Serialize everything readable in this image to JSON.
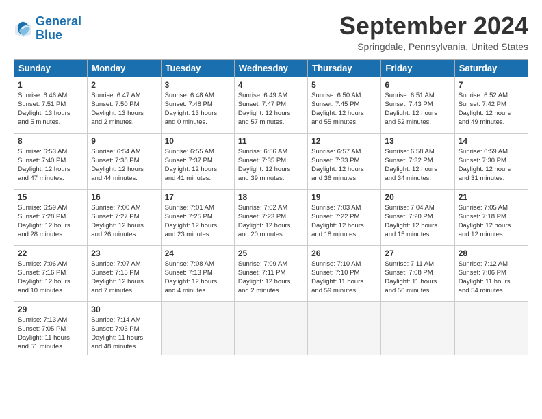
{
  "logo": {
    "line1": "General",
    "line2": "Blue"
  },
  "title": "September 2024",
  "location": "Springdale, Pennsylvania, United States",
  "weekdays": [
    "Sunday",
    "Monday",
    "Tuesday",
    "Wednesday",
    "Thursday",
    "Friday",
    "Saturday"
  ],
  "weeks": [
    [
      {
        "day": "1",
        "info": "Sunrise: 6:46 AM\nSunset: 7:51 PM\nDaylight: 13 hours\nand 5 minutes."
      },
      {
        "day": "2",
        "info": "Sunrise: 6:47 AM\nSunset: 7:50 PM\nDaylight: 13 hours\nand 2 minutes."
      },
      {
        "day": "3",
        "info": "Sunrise: 6:48 AM\nSunset: 7:48 PM\nDaylight: 13 hours\nand 0 minutes."
      },
      {
        "day": "4",
        "info": "Sunrise: 6:49 AM\nSunset: 7:47 PM\nDaylight: 12 hours\nand 57 minutes."
      },
      {
        "day": "5",
        "info": "Sunrise: 6:50 AM\nSunset: 7:45 PM\nDaylight: 12 hours\nand 55 minutes."
      },
      {
        "day": "6",
        "info": "Sunrise: 6:51 AM\nSunset: 7:43 PM\nDaylight: 12 hours\nand 52 minutes."
      },
      {
        "day": "7",
        "info": "Sunrise: 6:52 AM\nSunset: 7:42 PM\nDaylight: 12 hours\nand 49 minutes."
      }
    ],
    [
      {
        "day": "8",
        "info": "Sunrise: 6:53 AM\nSunset: 7:40 PM\nDaylight: 12 hours\nand 47 minutes."
      },
      {
        "day": "9",
        "info": "Sunrise: 6:54 AM\nSunset: 7:38 PM\nDaylight: 12 hours\nand 44 minutes."
      },
      {
        "day": "10",
        "info": "Sunrise: 6:55 AM\nSunset: 7:37 PM\nDaylight: 12 hours\nand 41 minutes."
      },
      {
        "day": "11",
        "info": "Sunrise: 6:56 AM\nSunset: 7:35 PM\nDaylight: 12 hours\nand 39 minutes."
      },
      {
        "day": "12",
        "info": "Sunrise: 6:57 AM\nSunset: 7:33 PM\nDaylight: 12 hours\nand 36 minutes."
      },
      {
        "day": "13",
        "info": "Sunrise: 6:58 AM\nSunset: 7:32 PM\nDaylight: 12 hours\nand 34 minutes."
      },
      {
        "day": "14",
        "info": "Sunrise: 6:59 AM\nSunset: 7:30 PM\nDaylight: 12 hours\nand 31 minutes."
      }
    ],
    [
      {
        "day": "15",
        "info": "Sunrise: 6:59 AM\nSunset: 7:28 PM\nDaylight: 12 hours\nand 28 minutes."
      },
      {
        "day": "16",
        "info": "Sunrise: 7:00 AM\nSunset: 7:27 PM\nDaylight: 12 hours\nand 26 minutes."
      },
      {
        "day": "17",
        "info": "Sunrise: 7:01 AM\nSunset: 7:25 PM\nDaylight: 12 hours\nand 23 minutes."
      },
      {
        "day": "18",
        "info": "Sunrise: 7:02 AM\nSunset: 7:23 PM\nDaylight: 12 hours\nand 20 minutes."
      },
      {
        "day": "19",
        "info": "Sunrise: 7:03 AM\nSunset: 7:22 PM\nDaylight: 12 hours\nand 18 minutes."
      },
      {
        "day": "20",
        "info": "Sunrise: 7:04 AM\nSunset: 7:20 PM\nDaylight: 12 hours\nand 15 minutes."
      },
      {
        "day": "21",
        "info": "Sunrise: 7:05 AM\nSunset: 7:18 PM\nDaylight: 12 hours\nand 12 minutes."
      }
    ],
    [
      {
        "day": "22",
        "info": "Sunrise: 7:06 AM\nSunset: 7:16 PM\nDaylight: 12 hours\nand 10 minutes."
      },
      {
        "day": "23",
        "info": "Sunrise: 7:07 AM\nSunset: 7:15 PM\nDaylight: 12 hours\nand 7 minutes."
      },
      {
        "day": "24",
        "info": "Sunrise: 7:08 AM\nSunset: 7:13 PM\nDaylight: 12 hours\nand 4 minutes."
      },
      {
        "day": "25",
        "info": "Sunrise: 7:09 AM\nSunset: 7:11 PM\nDaylight: 12 hours\nand 2 minutes."
      },
      {
        "day": "26",
        "info": "Sunrise: 7:10 AM\nSunset: 7:10 PM\nDaylight: 11 hours\nand 59 minutes."
      },
      {
        "day": "27",
        "info": "Sunrise: 7:11 AM\nSunset: 7:08 PM\nDaylight: 11 hours\nand 56 minutes."
      },
      {
        "day": "28",
        "info": "Sunrise: 7:12 AM\nSunset: 7:06 PM\nDaylight: 11 hours\nand 54 minutes."
      }
    ],
    [
      {
        "day": "29",
        "info": "Sunrise: 7:13 AM\nSunset: 7:05 PM\nDaylight: 11 hours\nand 51 minutes."
      },
      {
        "day": "30",
        "info": "Sunrise: 7:14 AM\nSunset: 7:03 PM\nDaylight: 11 hours\nand 48 minutes."
      },
      {
        "day": "",
        "info": ""
      },
      {
        "day": "",
        "info": ""
      },
      {
        "day": "",
        "info": ""
      },
      {
        "day": "",
        "info": ""
      },
      {
        "day": "",
        "info": ""
      }
    ]
  ]
}
